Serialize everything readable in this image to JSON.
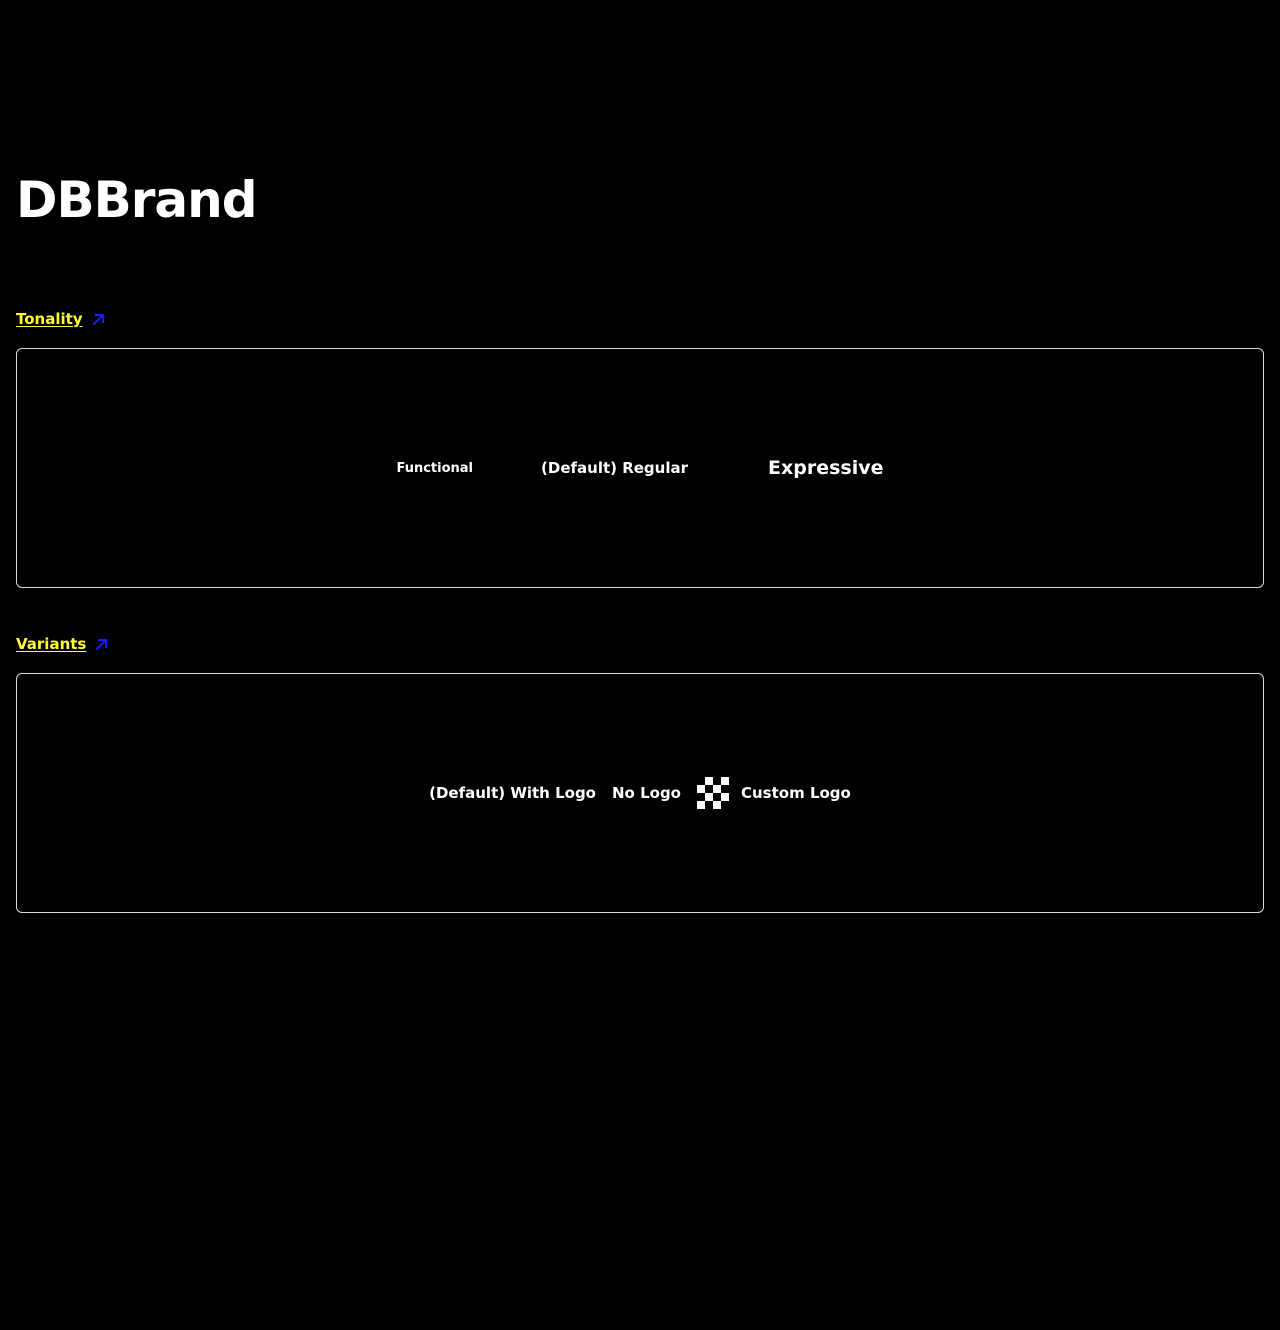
{
  "page": {
    "title": "DBBrand"
  },
  "sections": {
    "tonality": {
      "link_label": "Tonality",
      "items": {
        "functional": "Functional",
        "regular": "(Default) Regular",
        "expressive": "Expressive"
      }
    },
    "variants": {
      "link_label": "Variants",
      "items": {
        "with_logo": "(Default) With Logo",
        "no_logo": "No Logo",
        "custom_logo": "Custom Logo"
      }
    }
  },
  "icons": {
    "link_arrow": "arrow-up-right-icon",
    "custom_logo": "checkerboard-icon"
  },
  "colors": {
    "background": "#000000",
    "text": "#ffffff",
    "link": "#ffff33",
    "link_arrow": "#1a1aff",
    "box_border": "#d9d9d9"
  }
}
